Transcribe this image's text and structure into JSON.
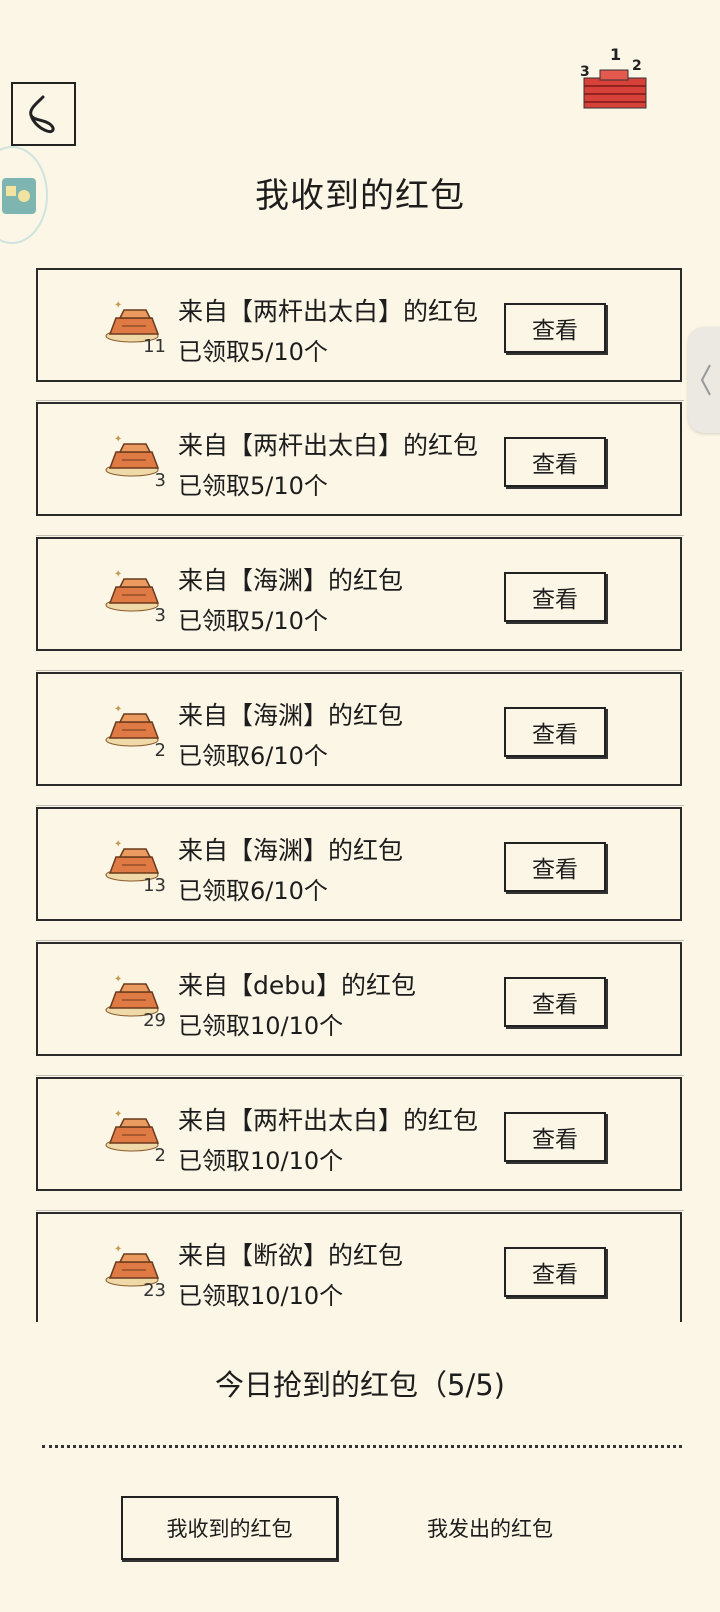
{
  "header": {
    "title": "我收到的红包",
    "back_icon": "back-arrow-icon",
    "rank_icon": "ranking-podium-icon",
    "rank_numbers": [
      "3",
      "1",
      "2"
    ]
  },
  "packets": [
    {
      "from": "来自【两杆出太白】的红包",
      "count": "11",
      "progress": "已领取5/10个",
      "button": "查看"
    },
    {
      "from": "来自【两杆出太白】的红包",
      "count": "3",
      "progress": "已领取5/10个",
      "button": "查看"
    },
    {
      "from": "来自【海渊】的红包",
      "count": "3",
      "progress": "已领取5/10个",
      "button": "查看"
    },
    {
      "from": "来自【海渊】的红包",
      "count": "2",
      "progress": "已领取6/10个",
      "button": "查看"
    },
    {
      "from": "来自【海渊】的红包",
      "count": "13",
      "progress": "已领取6/10个",
      "button": "查看"
    },
    {
      "from": "来自【debu】的红包",
      "count": "29",
      "progress": "已领取10/10个",
      "button": "查看"
    },
    {
      "from": "来自【两杆出太白】的红包",
      "count": "2",
      "progress": "已领取10/10个",
      "button": "查看"
    },
    {
      "from": "来自【断欲】的红包",
      "count": "23",
      "progress": "已领取10/10个",
      "button": "查看"
    }
  ],
  "footer": {
    "today_label": "今日抢到的红包（5/5)"
  },
  "tabs": {
    "received": "我收到的红包",
    "sent": "我发出的红包"
  },
  "colors": {
    "background": "#fbf6e6",
    "gold": "#e07a45",
    "red_packet": "#d8403a"
  }
}
